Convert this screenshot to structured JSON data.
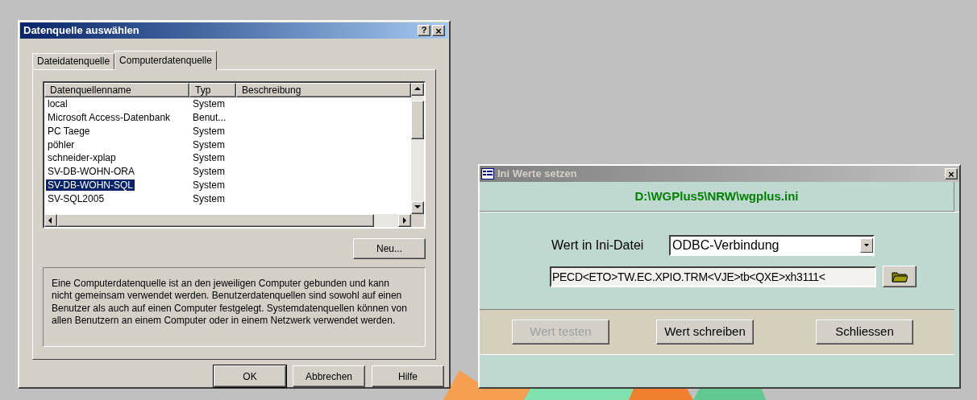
{
  "source_dialog": {
    "title": "Datenquelle auswählen",
    "help_button": "?",
    "close_button": "×",
    "tabs": [
      {
        "label": "Dateidatenquelle",
        "selected": false
      },
      {
        "label": "Computerdatenquelle",
        "selected": true
      }
    ],
    "table": {
      "columns": [
        "Datenquellenname",
        "Typ",
        "Beschreibung"
      ],
      "rows": [
        {
          "name": "local",
          "type": "System",
          "selected": false
        },
        {
          "name": "Microsoft Access-Datenbank",
          "type": "Benut...",
          "selected": false
        },
        {
          "name": "PC Taege",
          "type": "System",
          "selected": false
        },
        {
          "name": "pöhler",
          "type": "System",
          "selected": false
        },
        {
          "name": "schneider-xplap",
          "type": "System",
          "selected": false
        },
        {
          "name": "SV-DB-WOHN-ORA",
          "type": "System",
          "selected": false
        },
        {
          "name": "SV-DB-WOHN-SQL",
          "type": "System",
          "selected": true
        },
        {
          "name": "SV-SQL2005",
          "type": "System",
          "selected": false
        }
      ]
    },
    "new_button": "Neu...",
    "description": "Eine Computerdatenquelle ist an den jeweiligen Computer gebunden und kann nicht gemeinsam verwendet werden. Benutzerdatenquellen sind sowohl auf einen Benutzer als auch auf einen Computer festgelegt. Systemdatenquellen können von allen Benutzern an einem Computer oder in einem Netzwerk verwendet werden.",
    "buttons": [
      {
        "label": "OK",
        "default": true
      },
      {
        "label": "Abbrechen",
        "default": false
      },
      {
        "label": "Hilfe",
        "default": false
      }
    ]
  },
  "ini_dialog": {
    "title": "Ini Werte setzen",
    "close_button": "×",
    "file_path": "D:\\WGPlus5\\NRW\\wgplus.ini",
    "value_label": "Wert in Ini-Datei",
    "value_select": "ODBC-Verbindung",
    "value_field": "PECD<ETO>TW.EC.XPIO.TRM<VJE>tb<QXE>xh3111<",
    "buttons": [
      {
        "label": "Wert testen",
        "disabled": true
      },
      {
        "label": "Wert schreiben",
        "disabled": false
      },
      {
        "label": "Schliessen",
        "disabled": false
      }
    ]
  }
}
